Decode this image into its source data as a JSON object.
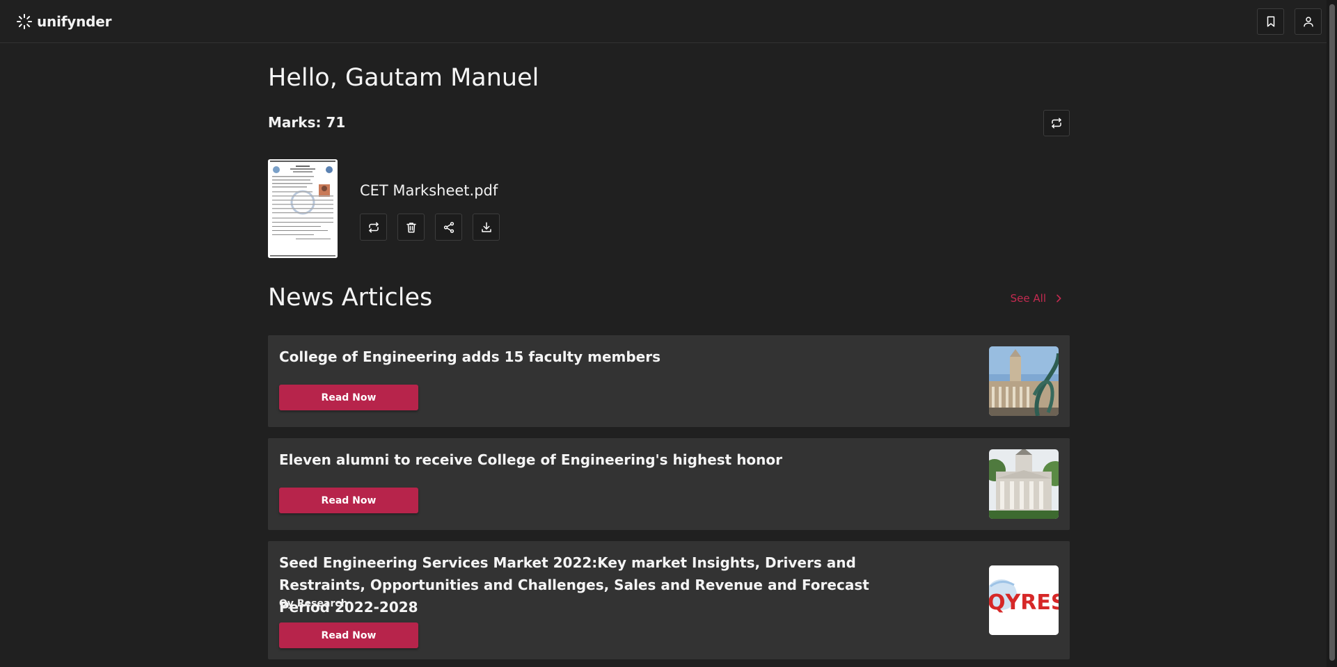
{
  "app": {
    "brand": "unifynder",
    "icons": {
      "brand": "loader-icon",
      "bookmark": "bookmark-icon",
      "profile": "user-icon"
    }
  },
  "main": {
    "greeting": "Hello, Gautam Manuel",
    "marks": "Marks: 71",
    "file": {
      "name": "CET Marksheet.pdf",
      "actions": [
        "replace-icon",
        "delete-icon",
        "share-icon",
        "download-icon"
      ]
    }
  },
  "news": {
    "heading": "News Articles",
    "see_all": "See All",
    "accent_color": "#b7244b",
    "articles": [
      {
        "title": "College of Engineering adds 15 faculty members",
        "button": "Read Now"
      },
      {
        "title": "Eleven alumni to receive College of Engineering's highest honor",
        "button": "Read Now"
      },
      {
        "title": "Seed Engineering Services Market 2022:Key market Insights, Drivers and Restraints, Opportunities and Challenges, Sales and Revenue and Forecast Period 2022-2028",
        "source": "Qy Research",
        "button": "Read Now",
        "image_text": "QYRESEA"
      }
    ]
  }
}
